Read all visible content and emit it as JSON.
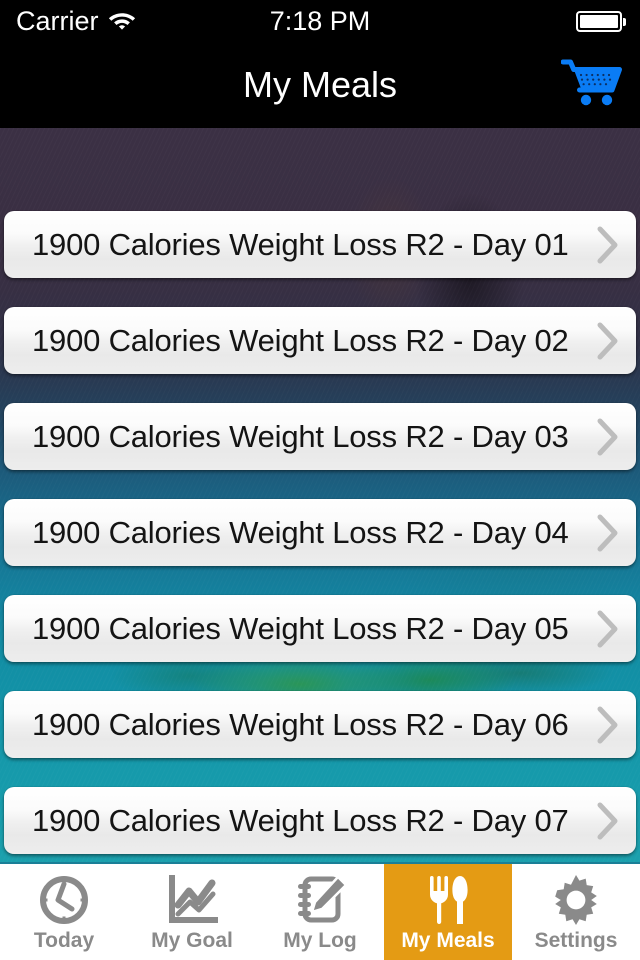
{
  "status_bar": {
    "carrier": "Carrier",
    "time": "7:18 PM",
    "wifi_icon": "wifi-icon",
    "battery_icon": "battery-full-icon"
  },
  "nav_bar": {
    "title": "My Meals",
    "cart_icon": "shopping-cart-icon",
    "cart_color": "#0a7cf5",
    "background": "#000000"
  },
  "meal_list": {
    "items": [
      {
        "label": "1900 Calories Weight Loss R2 - Day 01",
        "chevron": "chevron-right-icon"
      },
      {
        "label": "1900 Calories Weight Loss R2 - Day 02",
        "chevron": "chevron-right-icon"
      },
      {
        "label": "1900 Calories Weight Loss R2 - Day 03",
        "chevron": "chevron-right-icon"
      },
      {
        "label": "1900 Calories Weight Loss R2 - Day 04",
        "chevron": "chevron-right-icon"
      },
      {
        "label": "1900 Calories Weight Loss R2 - Day 05",
        "chevron": "chevron-right-icon"
      },
      {
        "label": "1900 Calories Weight Loss R2 - Day 06",
        "chevron": "chevron-right-icon"
      },
      {
        "label": "1900 Calories Weight Loss R2 - Day 07",
        "chevron": "chevron-right-icon"
      }
    ]
  },
  "tab_bar": {
    "selected_index": 3,
    "selected_color": "#e49b14",
    "inactive_color": "#8a8a8a",
    "tabs": [
      {
        "label": "Today",
        "icon": "clock-icon"
      },
      {
        "label": "My Goal",
        "icon": "line-chart-icon"
      },
      {
        "label": "My Log",
        "icon": "notepad-pencil-icon"
      },
      {
        "label": "My Meals",
        "icon": "fork-knife-icon"
      },
      {
        "label": "Settings",
        "icon": "gear-icon"
      }
    ]
  }
}
